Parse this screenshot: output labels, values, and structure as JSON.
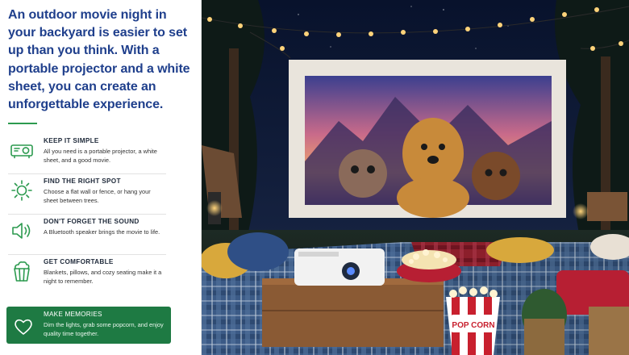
{
  "headline": "An outdoor movie night in your backyard is easier to set up than you think. With a portable projector and a white sheet, you can create an unforgettable experience.",
  "tips": [
    {
      "title": "KEEP IT SIMPLE",
      "desc": "All you need is a portable projector, a white sheet, and a good movie.",
      "icon": "projector-icon"
    },
    {
      "title": "FIND THE RIGHT SPOT",
      "desc": "Choose a flat wall or fence, or hang your sheet between trees.",
      "icon": "sun-icon"
    },
    {
      "title": "DON'T FORGET THE SOUND",
      "desc": "A Bluetooth speaker brings the movie to life.",
      "icon": "speaker-icon"
    },
    {
      "title": "GET COMFORTABLE",
      "desc": "Blankets, pillows, and cozy seating make it a night to remember.",
      "icon": "popcorn-icon"
    }
  ],
  "memories": {
    "title": "MAKE MEMORIES",
    "desc": "Dim the lights, grab some popcorn, and enjoy quality time together.",
    "icon": "heart-icon"
  },
  "scene": {
    "popcorn_box_text": "POP CORN"
  },
  "colors": {
    "headline": "#1f3f8c",
    "accent": "#2c9a4f",
    "memories_bg": "#1e7a43",
    "night_sky": "#0b1530"
  }
}
